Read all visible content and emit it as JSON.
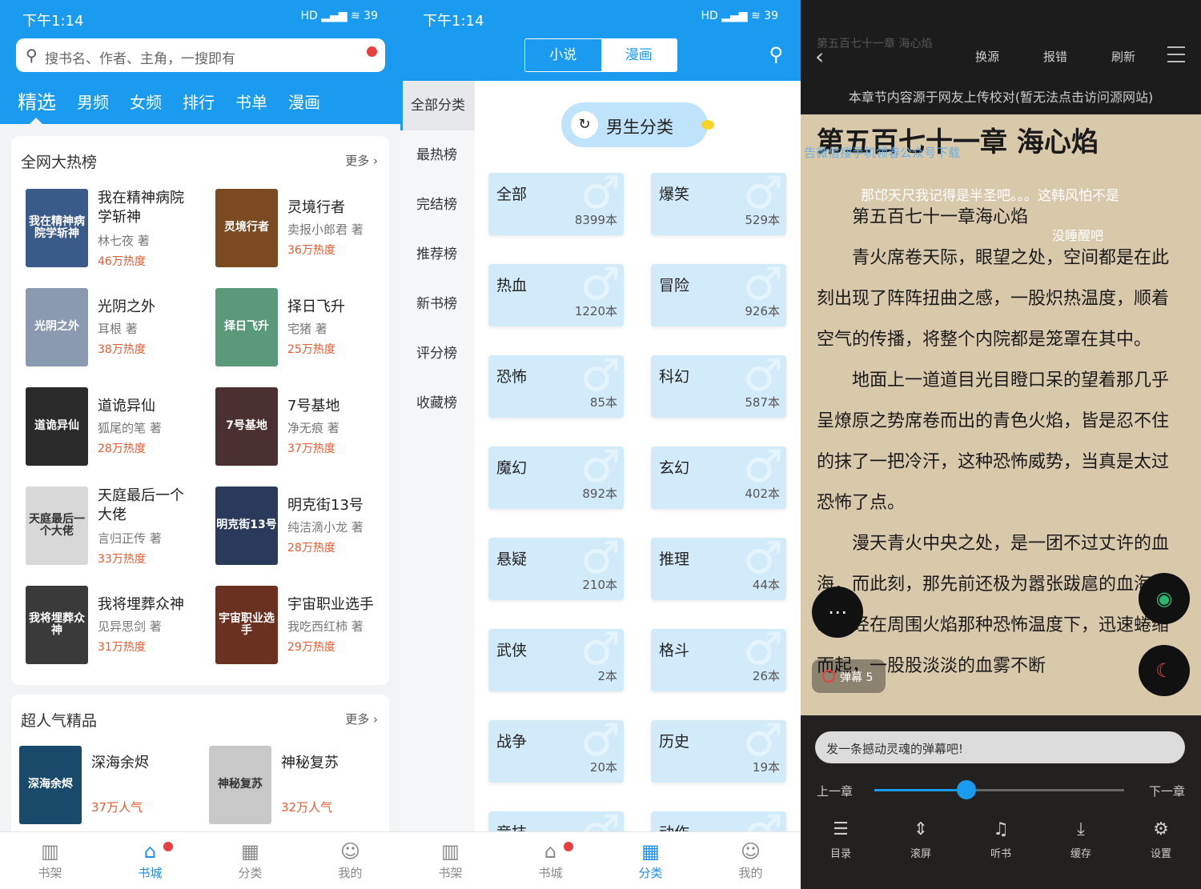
{
  "status": {
    "time": "下午1:14",
    "icons": "HD ▂▄▆ ≋ 39"
  },
  "home": {
    "search_placeholder": "搜书名、作者、主角，一搜即有",
    "tabs": [
      "精选",
      "男频",
      "女频",
      "排行",
      "书单",
      "漫画"
    ],
    "hot": {
      "title": "全网大热榜",
      "more": "更多 ›",
      "books": [
        {
          "title": "我在精神病院学斩神",
          "author": "林七夜 著",
          "heat": "46万热度",
          "cover": "我在精神病院学斩神",
          "color": "#3a5a8a"
        },
        {
          "title": "灵境行者",
          "author": "卖报小郎君 著",
          "heat": "36万热度",
          "cover": "灵境行者",
          "color": "#7a4a20"
        },
        {
          "title": "光阴之外",
          "author": "耳根 著",
          "heat": "38万热度",
          "cover": "光阴之外",
          "color": "#8a9ab0"
        },
        {
          "title": "择日飞升",
          "author": "宅猪 著",
          "heat": "25万热度",
          "cover": "择日飞升",
          "color": "#5a9a7a"
        },
        {
          "title": "道诡异仙",
          "author": "狐尾的笔 著",
          "heat": "28万热度",
          "cover": "道诡异仙",
          "color": "#2a2a2a"
        },
        {
          "title": "7号基地",
          "author": "净无痕 著",
          "heat": "37万热度",
          "cover": "7号基地",
          "color": "#4a3030"
        },
        {
          "title": "天庭最后一个大佬",
          "author": "言归正传 著",
          "heat": "33万热度",
          "cover": "天庭最后一个大佬",
          "color": "#d8d8d8"
        },
        {
          "title": "明克街13号",
          "author": "纯洁滴小龙 著",
          "heat": "28万热度",
          "cover": "明克街13号",
          "color": "#2a3a5a"
        },
        {
          "title": "我将埋葬众神",
          "author": "见异思剑 著",
          "heat": "31万热度",
          "cover": "我将埋葬众神",
          "color": "#3a3a3a"
        },
        {
          "title": "宇宙职业选手",
          "author": "我吃西红柿 著",
          "heat": "29万热度",
          "cover": "宇宙职业选手",
          "color": "#6a3020"
        }
      ]
    },
    "popular": {
      "title": "超人气精品",
      "more": "更多 ›",
      "books": [
        {
          "title": "深海余烬",
          "heat": "37万人气",
          "cover": "深海余烬",
          "color": "#1a4a6a"
        },
        {
          "title": "神秘复苏",
          "heat": "32万人气",
          "cover": "神秘复苏",
          "color": "#c8c8c8"
        }
      ]
    },
    "nav": [
      {
        "label": "书架",
        "icon": "▥"
      },
      {
        "label": "书城",
        "icon": "⌂"
      },
      {
        "label": "分类",
        "icon": "▦"
      },
      {
        "label": "我的",
        "icon": "☺"
      }
    ]
  },
  "category": {
    "seg": [
      "小说",
      "漫画"
    ],
    "side": [
      "全部分类",
      "最热榜",
      "完结榜",
      "推荐榜",
      "新书榜",
      "评分榜",
      "收藏榜"
    ],
    "pill": "男生分类",
    "cats": [
      {
        "name": "全部",
        "count": "8399本"
      },
      {
        "name": "爆笑",
        "count": "529本"
      },
      {
        "name": "热血",
        "count": "1220本"
      },
      {
        "name": "冒险",
        "count": "926本"
      },
      {
        "name": "恐怖",
        "count": "85本"
      },
      {
        "name": "科幻",
        "count": "587本"
      },
      {
        "name": "魔幻",
        "count": "892本"
      },
      {
        "name": "玄幻",
        "count": "402本"
      },
      {
        "name": "悬疑",
        "count": "210本"
      },
      {
        "name": "推理",
        "count": "44本"
      },
      {
        "name": "武侠",
        "count": "2本"
      },
      {
        "name": "格斗",
        "count": "26本"
      },
      {
        "name": "战争",
        "count": "20本"
      },
      {
        "name": "历史",
        "count": "19本"
      },
      {
        "name": "竞技",
        "count": ""
      },
      {
        "name": "动作",
        "count": ""
      }
    ],
    "nav": [
      {
        "label": "书架",
        "icon": "▥"
      },
      {
        "label": "书城",
        "icon": "⌂"
      },
      {
        "label": "分类",
        "icon": "▦"
      },
      {
        "label": "我的",
        "icon": "☺"
      }
    ]
  },
  "reader": {
    "ghost_title": "第五百七十一章 海心焰",
    "actions": [
      "换源",
      "报错",
      "刷新"
    ],
    "source_note": "本章节内容源于网友上传校对(暂无法点击访问源网站)",
    "chapter_title": "第五百七十一章 海心焰",
    "ad_text": "告微信搜手机领春公众号下载",
    "danmaku1": "那邙天尺我记得是半圣吧。。。这韩风怕不是",
    "danmaku2": "没睡醒吧",
    "body": [
      "　　第五百七十一章海心焰",
      "　　青火席卷天际，眼望之处，空间都是在此刻出现了阵阵扭曲之感，一股炽热温度，顺着空气的传播，将整个内院都是笼罩在其中。",
      "　　地面上一道道目光目瞪口呆的望着那几乎呈燎原之势席卷而出的青色火焰，皆是忍不住的抹了一把冷汗，这种恐怖威势，当真是太过恐怖了点。",
      "　　漫天青火中央之处，是一团不过丈许的血海，而此刻，那先前还极为嚣张跋扈的血海，却已经在周围火焰那种恐怖温度下，迅速蜷缩而起，一股股淡淡的血雾不断"
    ],
    "danmaku_tag": "弹幕 5",
    "input_placeholder": "发一条撼动灵魂的弹幕吧!",
    "prev": "上一章",
    "next": "下一章",
    "progress": 0.37,
    "tools": [
      {
        "label": "目录",
        "icon": "☰"
      },
      {
        "label": "滚屏",
        "icon": "⇕"
      },
      {
        "label": "听书",
        "icon": "♫"
      },
      {
        "label": "缓存",
        "icon": "⤓"
      },
      {
        "label": "设置",
        "icon": "⚙"
      }
    ],
    "colors": {
      "page": "#d8c9ab",
      "accent": "#1a9bf0"
    }
  }
}
